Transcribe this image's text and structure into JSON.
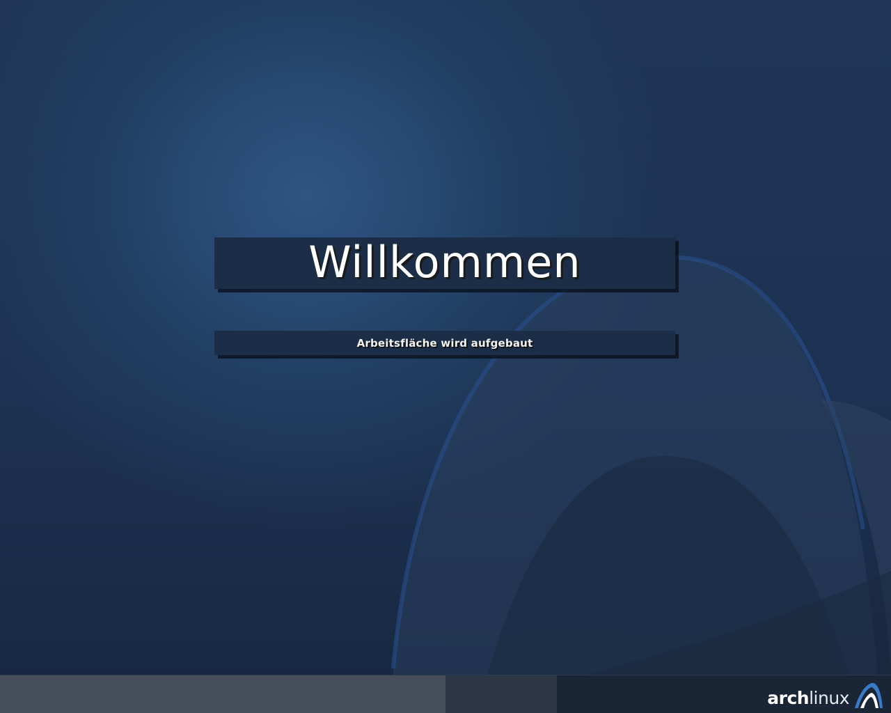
{
  "splash": {
    "title": "Willkommen",
    "status": "Arbeitsfläche wird aufgebaut"
  },
  "progress": {
    "fraction": 0.5,
    "segment_fraction": 0.625
  },
  "logo": {
    "part_bold": "arch",
    "part_light": "linux",
    "icon": "arch-linux-logo-icon"
  },
  "colors": {
    "background": "#1d3252",
    "panel": "#1c2d47",
    "accent": "#3a78c8",
    "text": "#ffffff"
  }
}
